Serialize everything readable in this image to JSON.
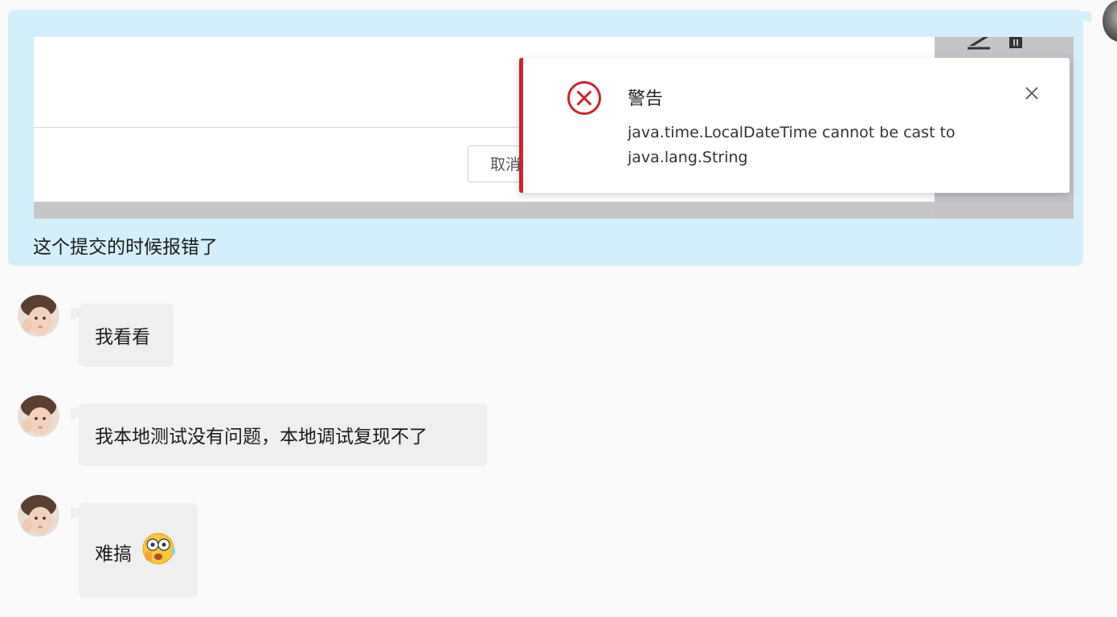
{
  "outgoing": {
    "screenshot": {
      "cancel_label": "取消",
      "toast": {
        "title": "警告",
        "message": "java.time.LocalDateTime cannot be cast to java.lang.String",
        "accent_color": "#d0232a"
      }
    },
    "text": "这个提交的时候报错了"
  },
  "incoming": [
    {
      "text": "我看看"
    },
    {
      "text": "我本地测试没有问题，本地调试复现不了"
    },
    {
      "text": "难搞",
      "emoji": "sweating-shocked-face-emoji"
    }
  ],
  "colors": {
    "outgoing_bubble": "#d3effb",
    "incoming_bubble": "#efefef",
    "background": "#fafafa"
  }
}
